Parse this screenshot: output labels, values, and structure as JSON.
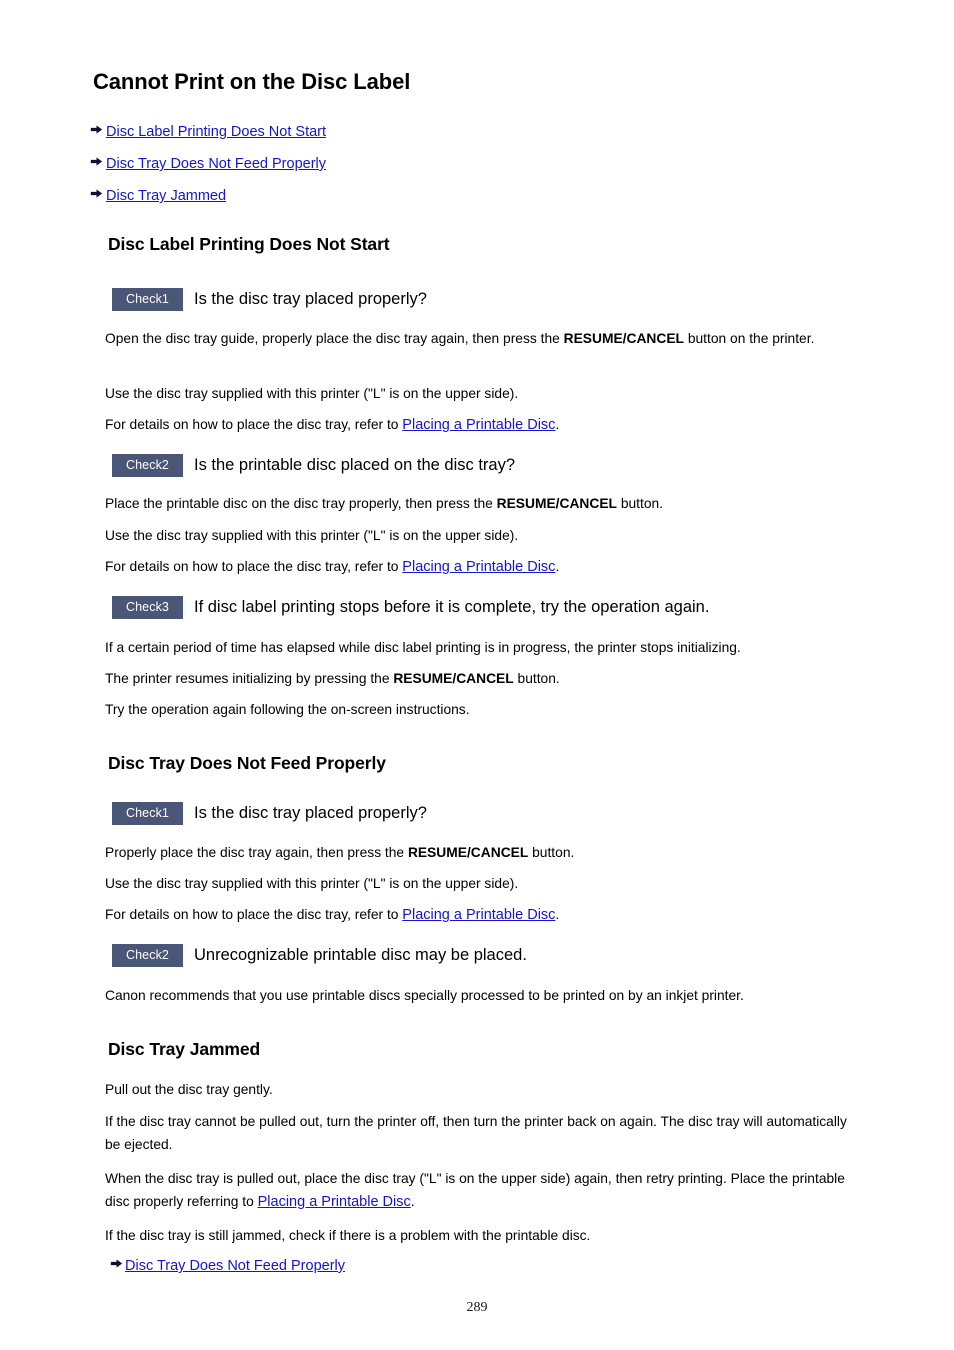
{
  "page": {
    "title": "Cannot Print on the Disc Label",
    "page_number": "289",
    "link_color": "#1414cc",
    "badge_color": "#4a5677",
    "arrow_icon": "arrow-right-icon"
  },
  "toc": [
    {
      "label": "Disc Label Printing Does Not Start"
    },
    {
      "label": "Disc Tray Does Not Feed Properly"
    },
    {
      "label": "Disc Tray Jammed"
    }
  ],
  "sections": {
    "s1": {
      "title": "Disc Label Printing Does Not Start",
      "check1": {
        "badge": "Check1",
        "heading": "Is the disc tray placed properly?",
        "p1_a": "Open the disc tray guide, properly place the disc tray again, then press the ",
        "p1_b": "RESUME/CANCEL",
        "p1_c": " button on the printer.",
        "p2": "Use the disc tray supplied with this printer (\"L\" is on the upper side).",
        "p3_a": "For details on how to place the disc tray, refer to ",
        "p3_link": "Placing a Printable Disc",
        "p3_c": "."
      },
      "check2": {
        "badge": "Check2",
        "heading": "Is the printable disc placed on the disc tray?",
        "p1_a": "Place the printable disc on the disc tray properly, then press the ",
        "p1_b": "RESUME/CANCEL",
        "p1_c": " button.",
        "p2": "Use the disc tray supplied with this printer (\"L\" is on the upper side).",
        "p3_a": "For details on how to place the disc tray, refer to ",
        "p3_link": "Placing a Printable Disc",
        "p3_c": "."
      },
      "check3": {
        "badge": "Check3",
        "heading": "If disc label printing stops before it is complete, try the operation again.",
        "p1": "If a certain period of time has elapsed while disc label printing is in progress, the printer stops initializing.",
        "p2_a": "The printer resumes initializing by pressing the ",
        "p2_b": "RESUME/CANCEL",
        "p2_c": " button.",
        "p3": "Try the operation again following the on-screen instructions."
      }
    },
    "s2": {
      "title": "Disc Tray Does Not Feed Properly",
      "check1": {
        "badge": "Check1",
        "heading": "Is the disc tray placed properly?",
        "p1_a": "Properly place the disc tray again, then press the ",
        "p1_b": "RESUME/CANCEL",
        "p1_c": " button.",
        "p2": "Use the disc tray supplied with this printer (\"L\" is on the upper side).",
        "p3_a": "For details on how to place the disc tray, refer to ",
        "p3_link": "Placing a Printable Disc",
        "p3_c": "."
      },
      "check2": {
        "badge": "Check2",
        "heading": "Unrecognizable printable disc may be placed.",
        "p1": "Canon recommends that you use printable discs specially processed to be printed on by an inkjet printer."
      }
    },
    "s3": {
      "title": "Disc Tray Jammed",
      "p1": "Pull out the disc tray gently.",
      "p2": "If the disc tray cannot be pulled out, turn the printer off, then turn the printer back on again. The disc tray will automatically be ejected.",
      "p3_a": "When the disc tray is pulled out, place the disc tray (\"L\" is on the upper side) again, then retry printing. Place the printable disc properly referring to ",
      "p3_link": "Placing a Printable Disc",
      "p3_c": ".",
      "p4": "If the disc tray is still jammed, check if there is a problem with the printable disc.",
      "link": "Disc Tray Does Not Feed Properly"
    }
  }
}
